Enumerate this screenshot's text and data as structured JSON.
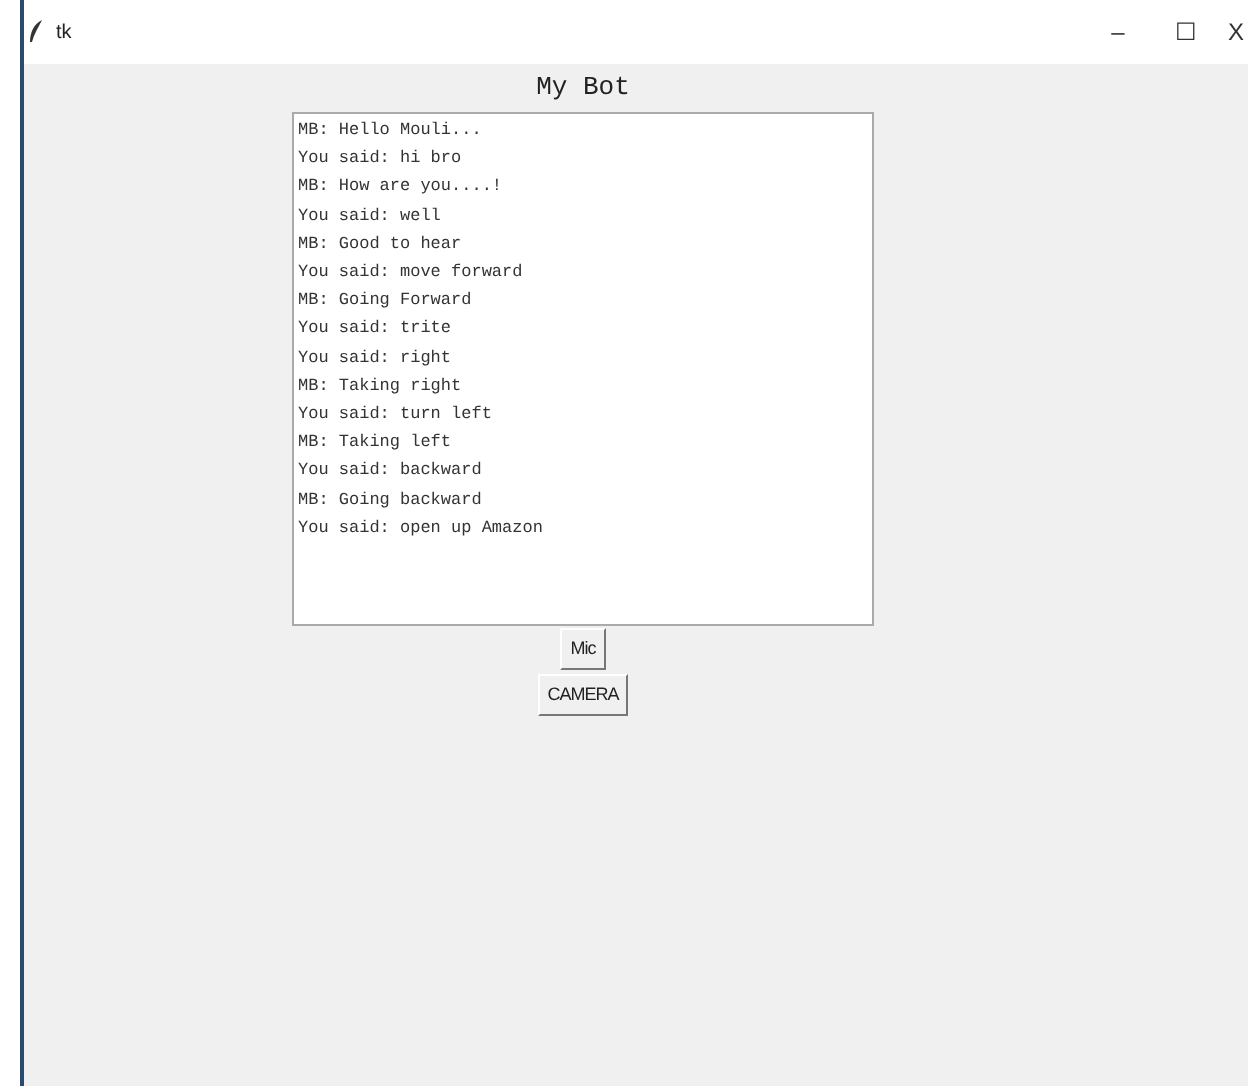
{
  "window": {
    "title": "tk",
    "controls": [
      "–",
      "☐",
      "X"
    ]
  },
  "heading": "My Bot",
  "chat_lines": [
    "MB: Hello Mouli...",
    "You said: hi bro",
    "MB: How are you....!",
    "You said: well",
    "MB: Good to hear",
    "You said: move forward",
    "MB: Going Forward",
    "You said: trite",
    "You said: right",
    "MB: Taking right",
    "You said: turn left",
    "MB: Taking left",
    "You said: backward",
    "MB: Going backward",
    "You said: open up Amazon"
  ],
  "buttons": [
    "Mic",
    "CAMERA"
  ]
}
